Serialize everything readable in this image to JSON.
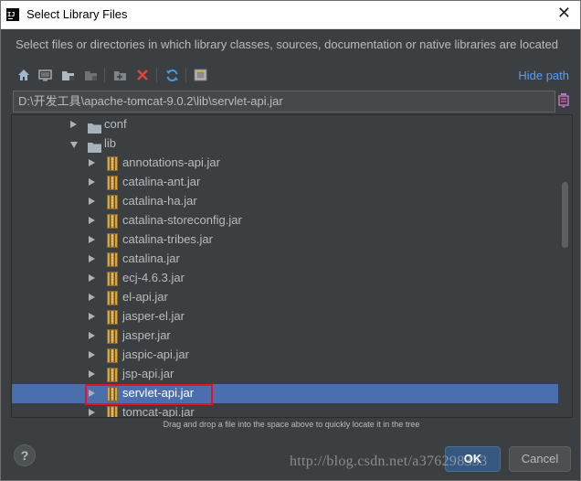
{
  "window": {
    "title": "Select Library Files",
    "description": "Select files or directories in which library classes, sources, documentation or native libraries are located"
  },
  "toolbar": {
    "buttons": [
      {
        "icon": "home-icon"
      },
      {
        "icon": "desktop-icon"
      },
      {
        "icon": "project-folder-icon"
      },
      {
        "icon": "module-folder-icon"
      },
      {
        "icon": "new-folder-icon"
      },
      {
        "icon": "delete-icon"
      },
      {
        "icon": "refresh-icon"
      },
      {
        "icon": "show-hidden-icon"
      }
    ],
    "hide_path": "Hide path"
  },
  "path": {
    "value": "D:\\开发工具\\apache-tomcat-9.0.2\\lib\\servlet-api.jar"
  },
  "tree": {
    "items": [
      {
        "label": "conf",
        "type": "folder",
        "expanded": false
      },
      {
        "label": "lib",
        "type": "folder",
        "expanded": true
      },
      {
        "label": "annotations-api.jar",
        "type": "jar"
      },
      {
        "label": "catalina-ant.jar",
        "type": "jar"
      },
      {
        "label": "catalina-ha.jar",
        "type": "jar"
      },
      {
        "label": "catalina-storeconfig.jar",
        "type": "jar"
      },
      {
        "label": "catalina-tribes.jar",
        "type": "jar"
      },
      {
        "label": "catalina.jar",
        "type": "jar"
      },
      {
        "label": "ecj-4.6.3.jar",
        "type": "jar"
      },
      {
        "label": "el-api.jar",
        "type": "jar"
      },
      {
        "label": "jasper-el.jar",
        "type": "jar"
      },
      {
        "label": "jasper.jar",
        "type": "jar"
      },
      {
        "label": "jaspic-api.jar",
        "type": "jar"
      },
      {
        "label": "jsp-api.jar",
        "type": "jar"
      },
      {
        "label": "servlet-api.jar",
        "type": "jar",
        "selected": true
      },
      {
        "label": "tomcat-api.jar",
        "type": "jar"
      }
    ]
  },
  "hint": "Drag and drop a file into the space above to quickly locate it in the tree",
  "buttons": {
    "help": "?",
    "ok": "OK",
    "cancel": "Cancel"
  },
  "watermark": "http://blog.csdn.net/a376298333",
  "colors": {
    "background": "#3c3f41",
    "selection": "#4b6eaf",
    "link": "#589df6",
    "highlight_border": "#e81123"
  }
}
